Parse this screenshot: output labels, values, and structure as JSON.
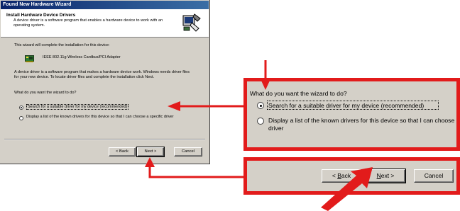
{
  "window": {
    "title": "Found New Hardware Wizard"
  },
  "header": {
    "title": "Install Hardware Device Drivers",
    "description": "A device driver is a software program that enables a hardware device to work with an operating system."
  },
  "body": {
    "intro": "This wizard will complete the installation for this device:",
    "device_name": "IEEE 802.11g Wireless Cardbus/PCI Adapter",
    "explanation": "A device driver is a software program that makes a hardware device work. Windows needs driver files for your new device. To locate driver files and complete the installation click Next.",
    "question": "What do you want the wizard to do?",
    "options": [
      {
        "label": "Search for a suitable driver for my device (recommended)",
        "selected": true
      },
      {
        "label": "Display a list of the known drivers for this device so that I can choose a specific driver",
        "selected": false
      }
    ]
  },
  "buttons": {
    "back": "< Back",
    "next": "Next >",
    "cancel": "Cancel"
  },
  "zoom_question": {
    "question": "What do you want the wizard to do?",
    "option1": "Search for a suitable driver for my device (recommended)",
    "option2_line1": "Display a list of the known drivers for this device so that I can choose",
    "option2_line2": "driver"
  },
  "zoom_buttons": {
    "back_prefix": "< ",
    "back_underlined": "B",
    "back_rest": "ack",
    "next_underlined": "N",
    "next_rest": "ext >",
    "cancel": "Cancel"
  },
  "colors": {
    "annotation_red": "#e21b1b",
    "window_face": "#d4d0c8",
    "title_gradient_start": "#0a246a"
  },
  "icons": {
    "header": "hardware-wizard-icon",
    "device": "network-adapter-icon"
  }
}
